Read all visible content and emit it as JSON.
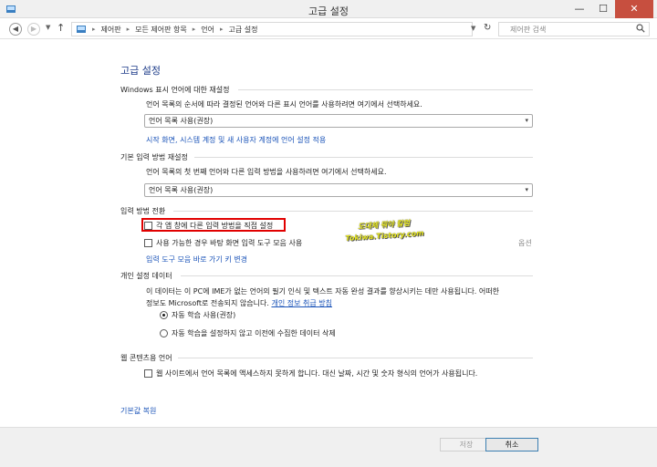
{
  "window": {
    "title": "고급 설정",
    "min": "—",
    "max": "☐",
    "close": "✕"
  },
  "address": {
    "breadcrumbs": [
      "제어판",
      "모든 제어판 항목",
      "언어",
      "고급 설정"
    ],
    "search_placeholder": "제어판 검색"
  },
  "page": {
    "title": "고급 설정",
    "sections": {
      "display_language": {
        "header": "Windows 표시 언어에 대한 재설정",
        "description": "언어 목록의 순서에 따라 결정된 언어와 다른 표시 언어를 사용하려면 여기에서 선택하세요.",
        "select_value": "언어 목록 사용(권장)",
        "link": "시작 화면, 시스템 계정 및 새 사용자 계정에 언어 설정 적용"
      },
      "input_method": {
        "header": "기본 입력 방법 재설정",
        "description": "언어 목록의 첫 번째 언어와 다른 입력 방법을 사용하려면 여기에서 선택하세요.",
        "select_value": "언어 목록 사용(권장)"
      },
      "switching": {
        "header": "입력 방법 전환",
        "checkbox1": "각 앱 창에 다른 입력 방법을 직접 설정",
        "checkbox2": "사용 가능한 경우 바탕 화면 입력 도구 모음 사용",
        "options": "옵션",
        "link": "입력 도구 모음 바로 가기 키 변경"
      },
      "personalization": {
        "header": "개인 설정 데이터",
        "text_line1": "이 데이터는 이 PC에 IME가 없는 언어의 필기 인식 및 텍스트 자동 완성 결과를 향상시키는 데만 사용됩니다. 어떠한",
        "text_line2": "정보도 Microsoft로 전송되지 않습니다.",
        "privacy_link": "개인 정보 취급 방침",
        "radio1": "자동 학습 사용(권장)",
        "radio2": "자동 학습을 설정하지 않고 이전에 수집한 데이터 삭제"
      },
      "web_content": {
        "header": "웹 콘텐츠용 언어",
        "checkbox": "웹 사이트에서 언어 목록에 액세스하지 못하게 합니다. 대신 날짜, 시간 및 숫자 형식의 언어가 사용됩니다."
      }
    },
    "restore_defaults": "기본값 복원",
    "watermark_line1": "도대체 뭐야 칼럼",
    "watermark_line2": "Tokiwa.Tistory.com"
  },
  "footer": {
    "save": "저장",
    "cancel": "취소"
  },
  "colors": {
    "link": "#1a53b8",
    "title": "#1e3d8a",
    "highlight": "#e10000",
    "close_button": "#c74f3f"
  }
}
